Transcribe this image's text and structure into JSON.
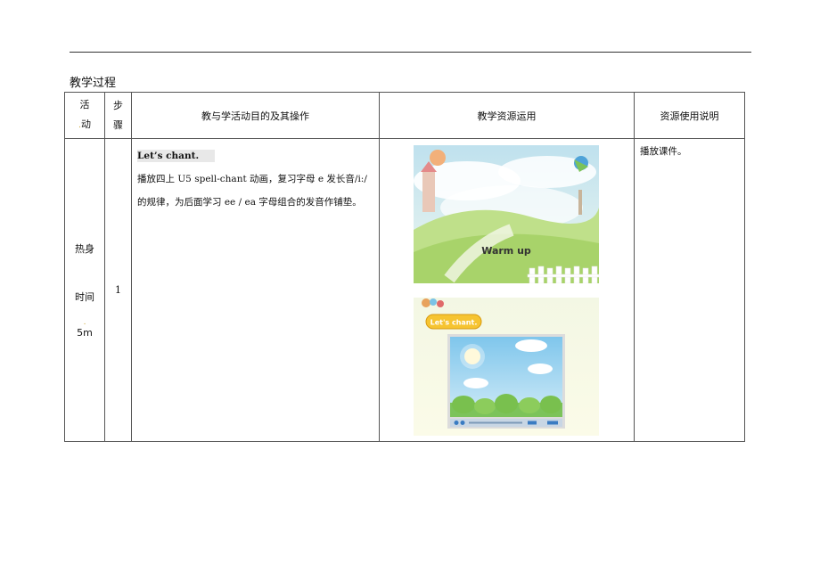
{
  "section_title": "教学过程",
  "table": {
    "headers": {
      "activity": [
        "活",
        "动"
      ],
      "step": [
        "步",
        "骤"
      ],
      "content": "教与学活动目的及其操作",
      "resources": "教学资源运用",
      "usage": "资源使用说明"
    },
    "row": {
      "activity_name": "热身",
      "time_label": "时间",
      "time_value": "5m",
      "step_number": "1",
      "chant_title": "Let’s chant.",
      "description_line1": "播放四上 U5    spell-chant 动画，复习字母 e 发长音/i:/",
      "description_line2": "的规律，为后面学习 ee / ea 字母组合的发音作铺垫。",
      "usage_note": "播放课件。"
    }
  },
  "slides": {
    "warmup_text": "Warm up",
    "chant_tag": "Let's chant."
  },
  "colors": {
    "sky": "#c9e4f0",
    "hill": "#a8d36a",
    "cloud": "#ffffff",
    "badge": "#f6c431"
  }
}
